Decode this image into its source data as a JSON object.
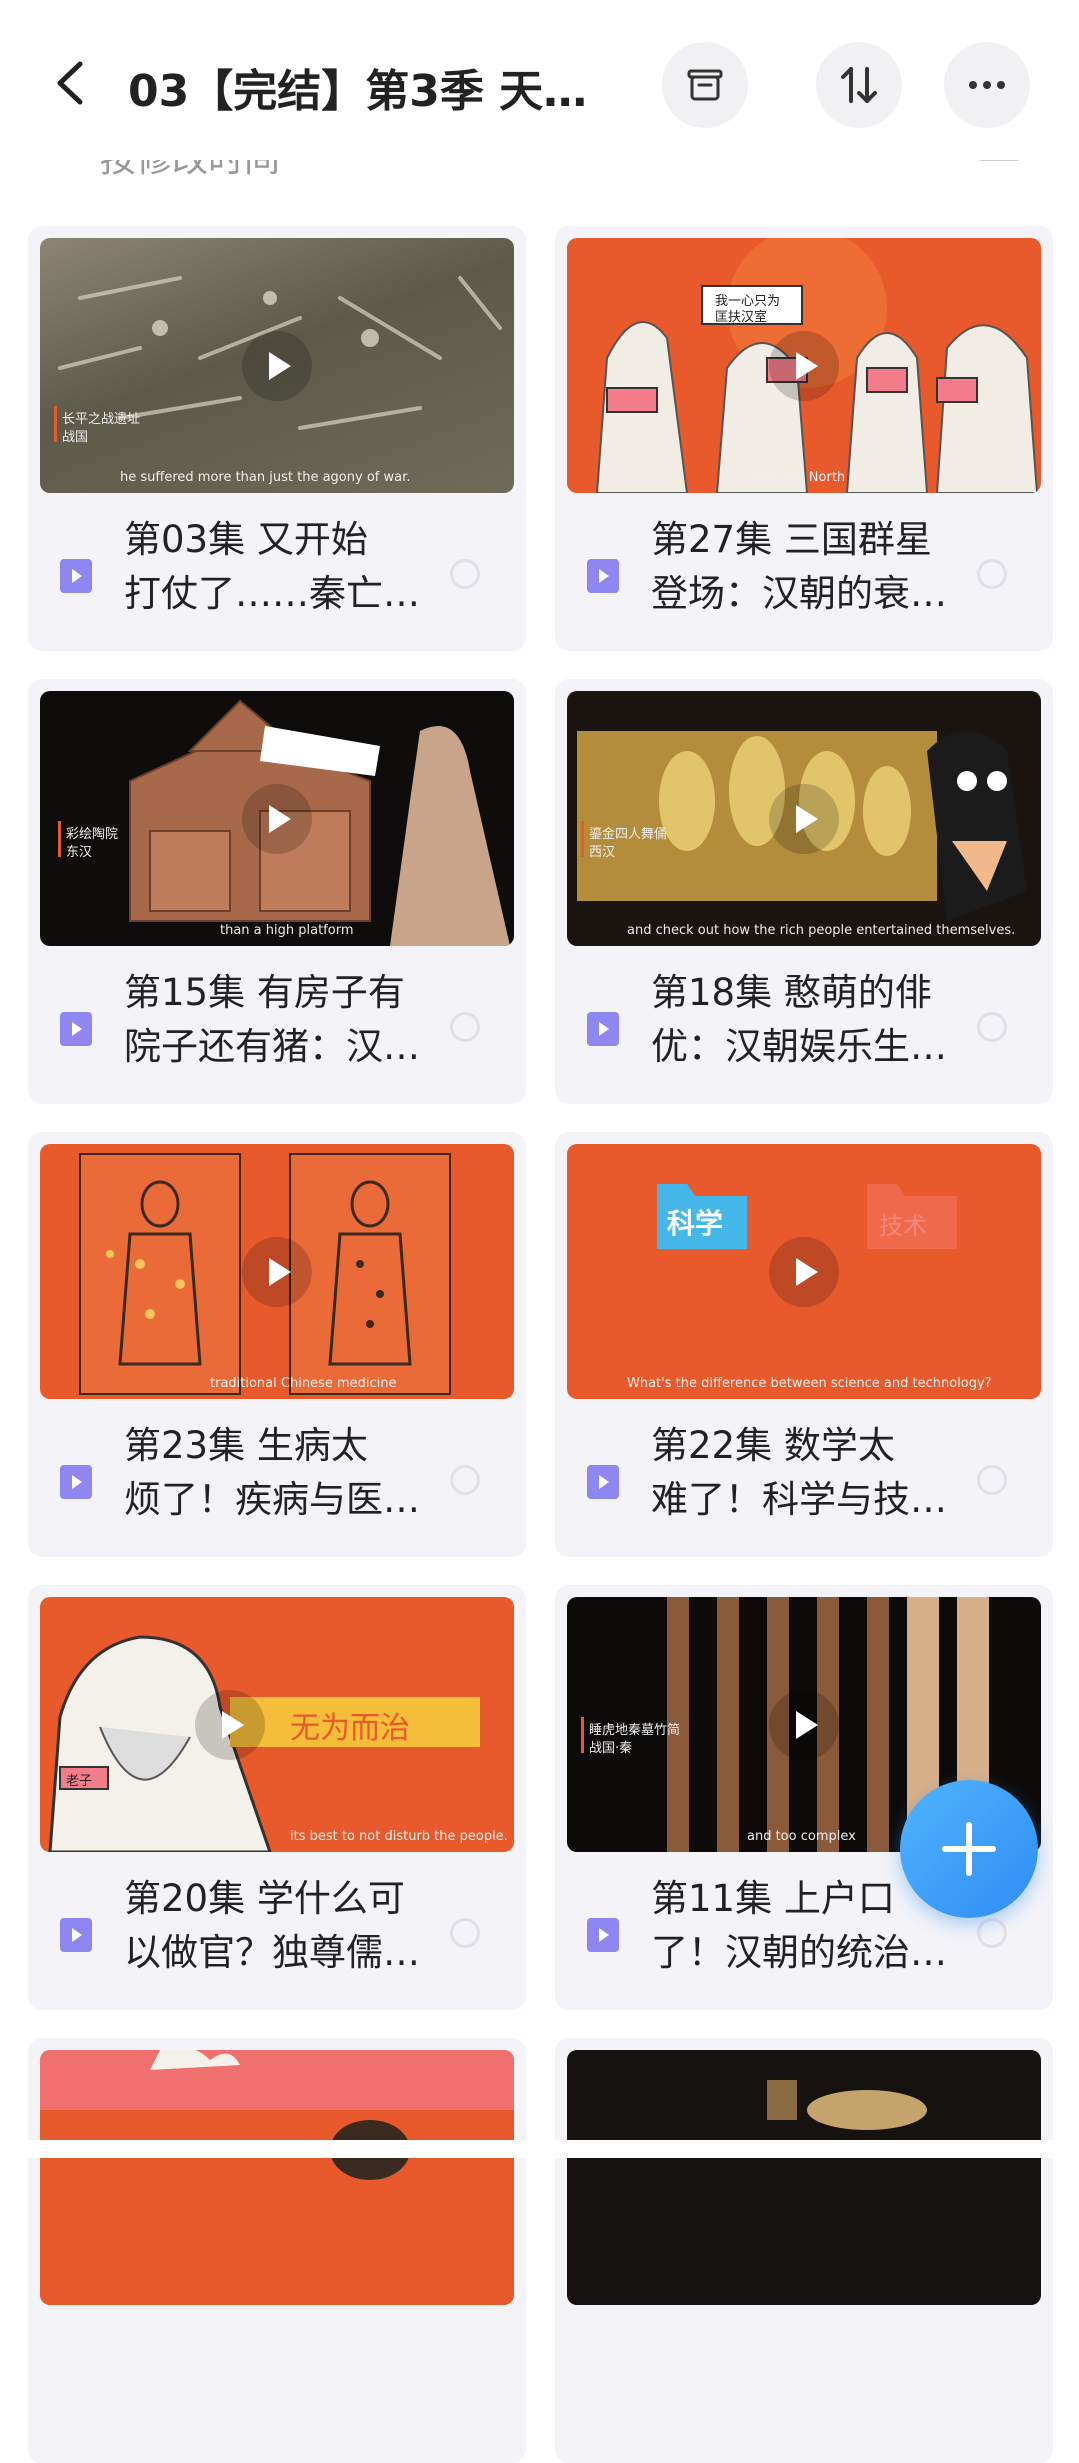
{
  "header": {
    "title": "03【完结】第3季 天…",
    "back_icon": "chevron-left-icon",
    "buttons": [
      "archive-icon",
      "sort-icon",
      "more-icon"
    ]
  },
  "sortbar": {
    "label": "按修改时间"
  },
  "colors": {
    "accent": "#8f87f1",
    "fab": "#2f8df2",
    "card_bg": "#f3f3f8",
    "orange": "#e85a2c"
  },
  "items": [
    {
      "line1": "第03集 又开始",
      "line2": "打仗了……秦亡…",
      "caption": "he suffered more than just the agony of war.",
      "tag1": "长平之战遗址",
      "tag2": "战国",
      "theme": "sand"
    },
    {
      "line1": "第27集 三国群星",
      "line2": "登场：汉朝的衰…",
      "caption": "From the North",
      "tag1": "我一心只为",
      "tag2": "匡扶汉室",
      "theme": "orange-figures"
    },
    {
      "line1": "第15集 有房子有",
      "line2": "院子还有猪：汉…",
      "caption": "than a high platform",
      "tag1": "彩绘陶院",
      "tag2": "东汉",
      "theme": "dark-house"
    },
    {
      "line1": "第18集 憨萌的俳",
      "line2": "优：汉朝娱乐生…",
      "caption": "and check out how the rich people entertained themselves.",
      "tag1": "鎏金四人舞俑",
      "tag2": "西汉",
      "theme": "dark-gold"
    },
    {
      "line1": "第23集 生病太",
      "line2": "烦了！疾病与医…",
      "caption": "traditional Chinese medicine",
      "tag1": "",
      "tag2": "",
      "theme": "orange-body"
    },
    {
      "line1": "第22集 数学太",
      "line2": "难了！科学与技…",
      "caption": "What's the difference between science and technology?",
      "tag1": "科学",
      "tag2": "技术",
      "theme": "orange-folders"
    },
    {
      "line1": "第20集 学什么可",
      "line2": "以做官？独尊儒…",
      "caption": "its best to not disturb the people.",
      "tag1": "老子",
      "tag2": "无为而治",
      "theme": "orange-laozi"
    },
    {
      "line1": "第11集 上户口",
      "line2": "了！汉朝的统治…",
      "caption": "and too complex",
      "tag1": "睡虎地秦墓竹简",
      "tag2": "战国·秦",
      "theme": "bamboo"
    },
    {
      "line1": "",
      "line2": "",
      "caption": "",
      "tag1": "",
      "tag2": "",
      "theme": "partial-orange"
    },
    {
      "line1": "",
      "line2": "",
      "caption": "",
      "tag1": "",
      "tag2": "",
      "theme": "partial-dark"
    }
  ]
}
